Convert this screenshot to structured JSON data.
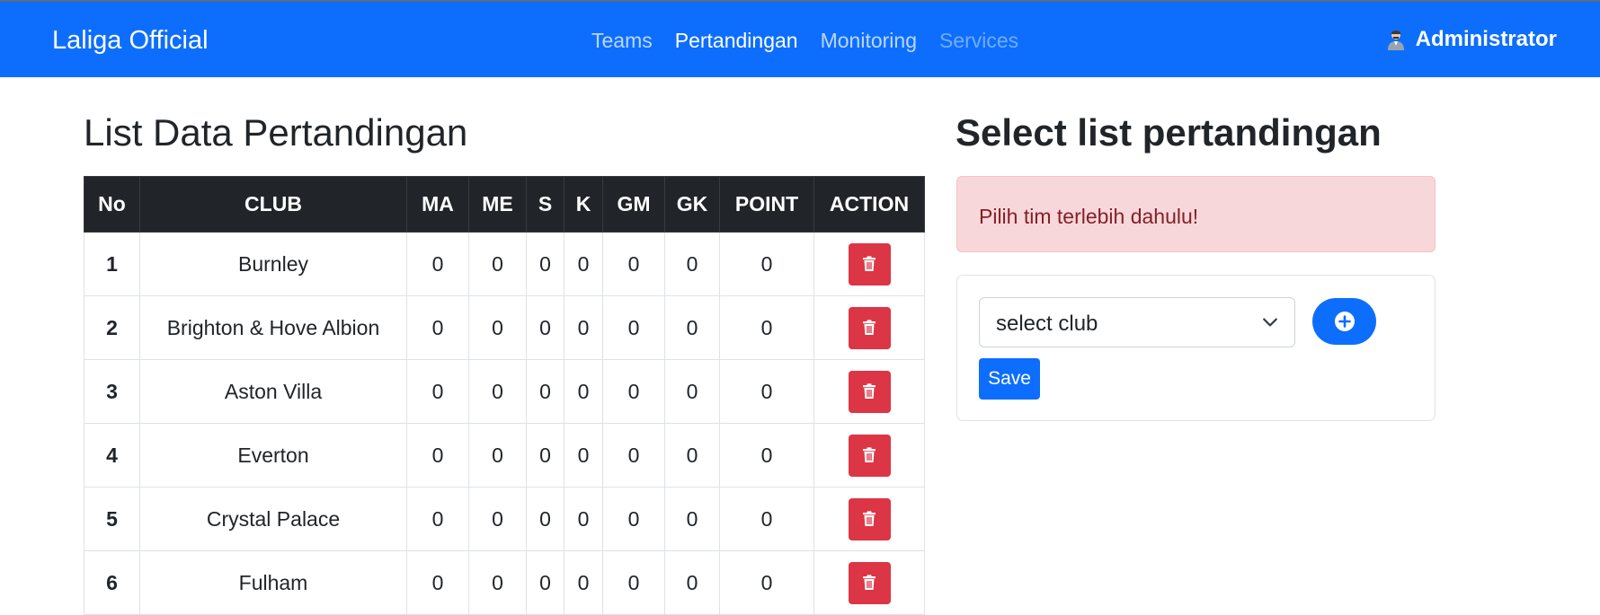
{
  "navbar": {
    "brand": "Laliga Official",
    "links": [
      {
        "label": "Teams"
      },
      {
        "label": "Pertandingan"
      },
      {
        "label": "Monitoring"
      },
      {
        "label": "Services"
      }
    ],
    "user": {
      "label": "Administrator",
      "icon": "user-avatar-icon"
    }
  },
  "left": {
    "title": "List Data Pertandingan",
    "columns": [
      "No",
      "CLUB",
      "MA",
      "ME",
      "S",
      "K",
      "GM",
      "GK",
      "POINT",
      "ACTION"
    ],
    "rows": [
      {
        "no": "1",
        "club": "Burnley",
        "ma": "0",
        "me": "0",
        "s": "0",
        "k": "0",
        "gm": "0",
        "gk": "0",
        "point": "0"
      },
      {
        "no": "2",
        "club": "Brighton & Hove Albion",
        "ma": "0",
        "me": "0",
        "s": "0",
        "k": "0",
        "gm": "0",
        "gk": "0",
        "point": "0"
      },
      {
        "no": "3",
        "club": "Aston Villa",
        "ma": "0",
        "me": "0",
        "s": "0",
        "k": "0",
        "gm": "0",
        "gk": "0",
        "point": "0"
      },
      {
        "no": "4",
        "club": "Everton",
        "ma": "0",
        "me": "0",
        "s": "0",
        "k": "0",
        "gm": "0",
        "gk": "0",
        "point": "0"
      },
      {
        "no": "5",
        "club": "Crystal Palace",
        "ma": "0",
        "me": "0",
        "s": "0",
        "k": "0",
        "gm": "0",
        "gk": "0",
        "point": "0"
      },
      {
        "no": "6",
        "club": "Fulham",
        "ma": "0",
        "me": "0",
        "s": "0",
        "k": "0",
        "gm": "0",
        "gk": "0",
        "point": "0"
      }
    ],
    "action_icon": "trash-icon"
  },
  "right": {
    "title": "Select list pertandingan",
    "alert": "Pilih tim terlebih dahulu!",
    "select_value": "select club",
    "add_icon": "plus-circle-icon",
    "save_label": "Save"
  },
  "colors": {
    "primary": "#0d6efd",
    "danger": "#dc3545",
    "dark": "#212529",
    "alert_bg": "#f8d7da",
    "alert_text": "#842029"
  }
}
